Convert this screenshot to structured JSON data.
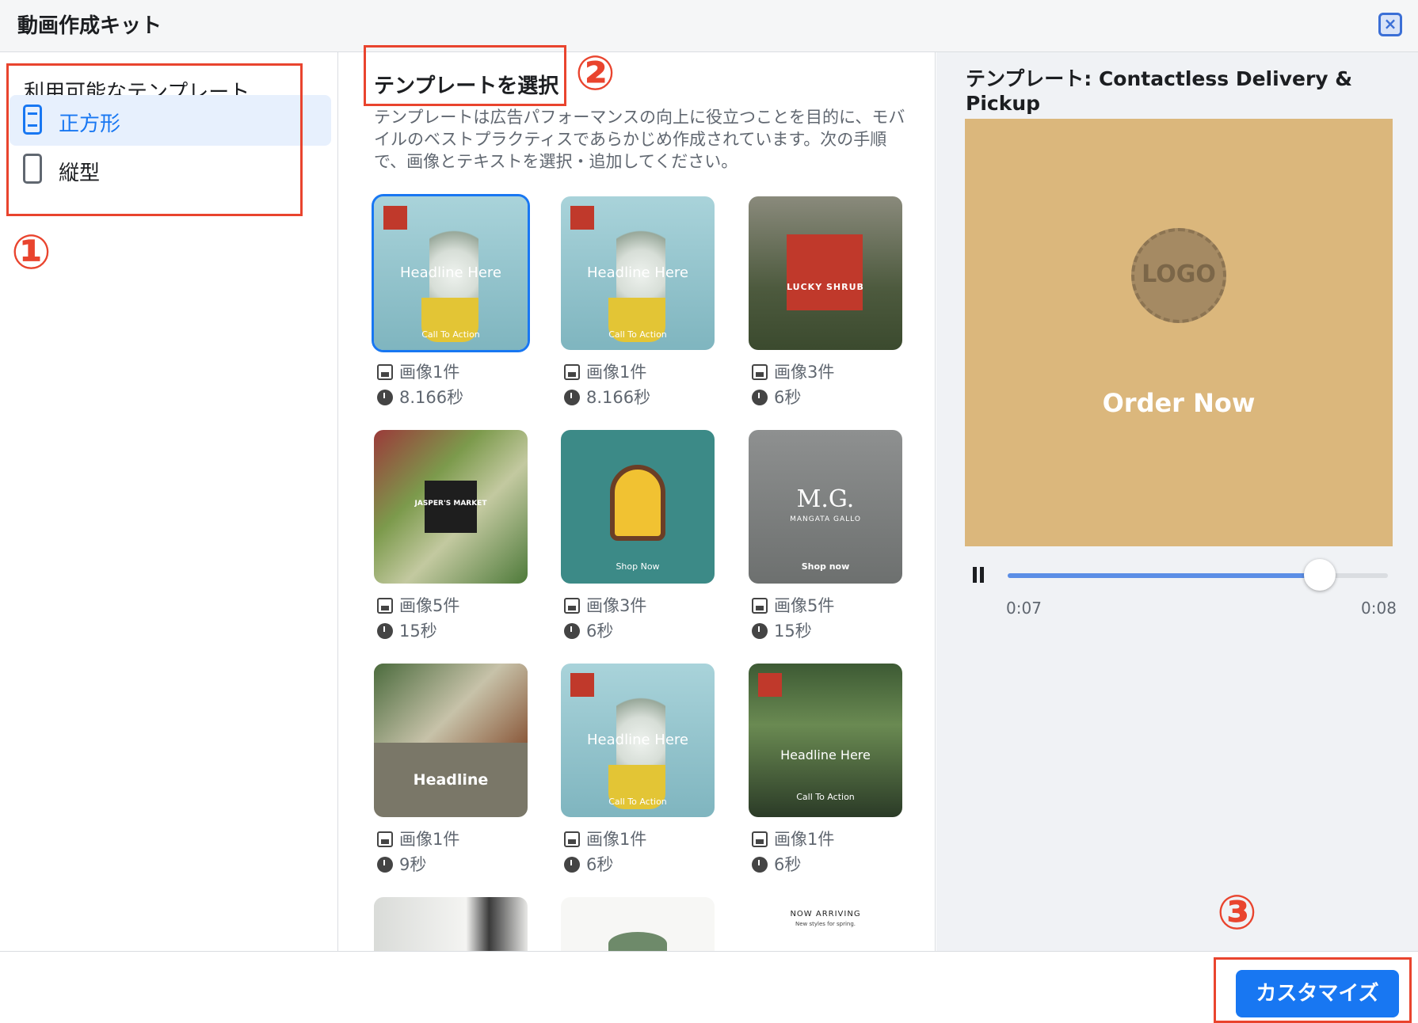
{
  "header": {
    "title": "動画作成キット",
    "close_icon": "close-icon"
  },
  "left": {
    "title": "利用可能なテンプレート",
    "items": [
      {
        "label": "正方形",
        "icon": "phone-square-icon",
        "selected": true
      },
      {
        "label": "縦型",
        "icon": "phone-vertical-icon",
        "selected": false
      }
    ]
  },
  "middle": {
    "title": "テンプレートを選択",
    "description": "テンプレートは広告パフォーマンスの向上に役立つことを目的に、モバイルのベストプラクティスであらかじめ作成されています。次の手順で、画像とテキストを選択・追加してください。",
    "templates": [
      {
        "images": "画像1件",
        "duration": "8.166秒",
        "headline": "Headline Here",
        "cta": "Call To Action",
        "selected": true
      },
      {
        "images": "画像1件",
        "duration": "8.166秒",
        "headline": "Headline Here",
        "cta": "Call To Action"
      },
      {
        "images": "画像3件",
        "duration": "6秒",
        "brand": "LUCKY SHRUB"
      },
      {
        "images": "画像5件",
        "duration": "15秒",
        "brand": "JASPER'S MARKET"
      },
      {
        "images": "画像3件",
        "duration": "6秒",
        "cta": "Shop Now"
      },
      {
        "images": "画像5件",
        "duration": "15秒",
        "brand": "M.G.",
        "tagline": "MANGATA GALLO",
        "cta": "Shop now"
      },
      {
        "images": "画像1件",
        "duration": "9秒",
        "headline": "Headline"
      },
      {
        "images": "画像1件",
        "duration": "6秒",
        "headline": "Headline Here",
        "cta": "Call To Action"
      },
      {
        "images": "画像1件",
        "duration": "6秒",
        "headline": "Headline Here",
        "cta": "Call To Action"
      }
    ],
    "partial": [
      {
        "text": ""
      },
      {
        "text": ""
      },
      {
        "text": "NOW ARRIVING",
        "sub": "New styles for spring."
      }
    ]
  },
  "right": {
    "title": "テンプレート: Contactless Delivery & Pickup",
    "preview": {
      "logo": "LOGO",
      "cta": "Order Now",
      "bg_color": "#dbb77c"
    },
    "player": {
      "current": "0:07",
      "total": "0:08",
      "progress": 0.82
    }
  },
  "footer": {
    "customize": "カスタマイズ"
  },
  "annotations": {
    "n1": "①",
    "n2": "②",
    "n3": "③",
    "color": "#e9442e"
  }
}
